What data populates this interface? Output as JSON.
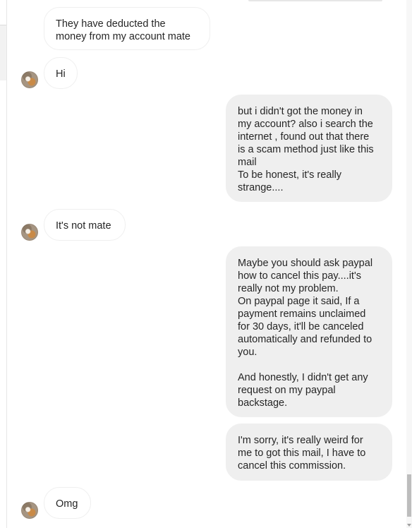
{
  "messages": [
    {
      "side": "incoming",
      "text": "They have deducted the\nmoney from my account mate",
      "avatar": false
    },
    {
      "side": "incoming",
      "text": "Hi",
      "avatar": true
    },
    {
      "side": "outgoing",
      "text": "but i didn't got the money in\nmy account? also i search the\ninternet , found out that there\nis a scam method just like this\nmail\nTo be honest, it's really\nstrange....",
      "avatar": false
    },
    {
      "side": "incoming",
      "text": "It's not mate",
      "avatar": true
    },
    {
      "side": "outgoing",
      "text": "Maybe you should ask paypal\nhow to cancel this pay....it's\nreally not my problem.\nOn paypal page it said, If a\npayment remains unclaimed\nfor 30 days, it'll be canceled\nautomatically and refunded to\nyou.\n\nAnd honestly, I didn't get any\nrequest on my paypal\nbackstage.",
      "avatar": false
    },
    {
      "side": "outgoing",
      "text": "I'm sorry, it's really weird for\nme to got this mail, I have to\ncancel this commission.",
      "avatar": false
    },
    {
      "side": "incoming",
      "text": "Omg",
      "avatar": true
    }
  ],
  "colors": {
    "incoming_bubble": "#ffffff",
    "outgoing_bubble": "#efefef",
    "text": "#262626"
  }
}
